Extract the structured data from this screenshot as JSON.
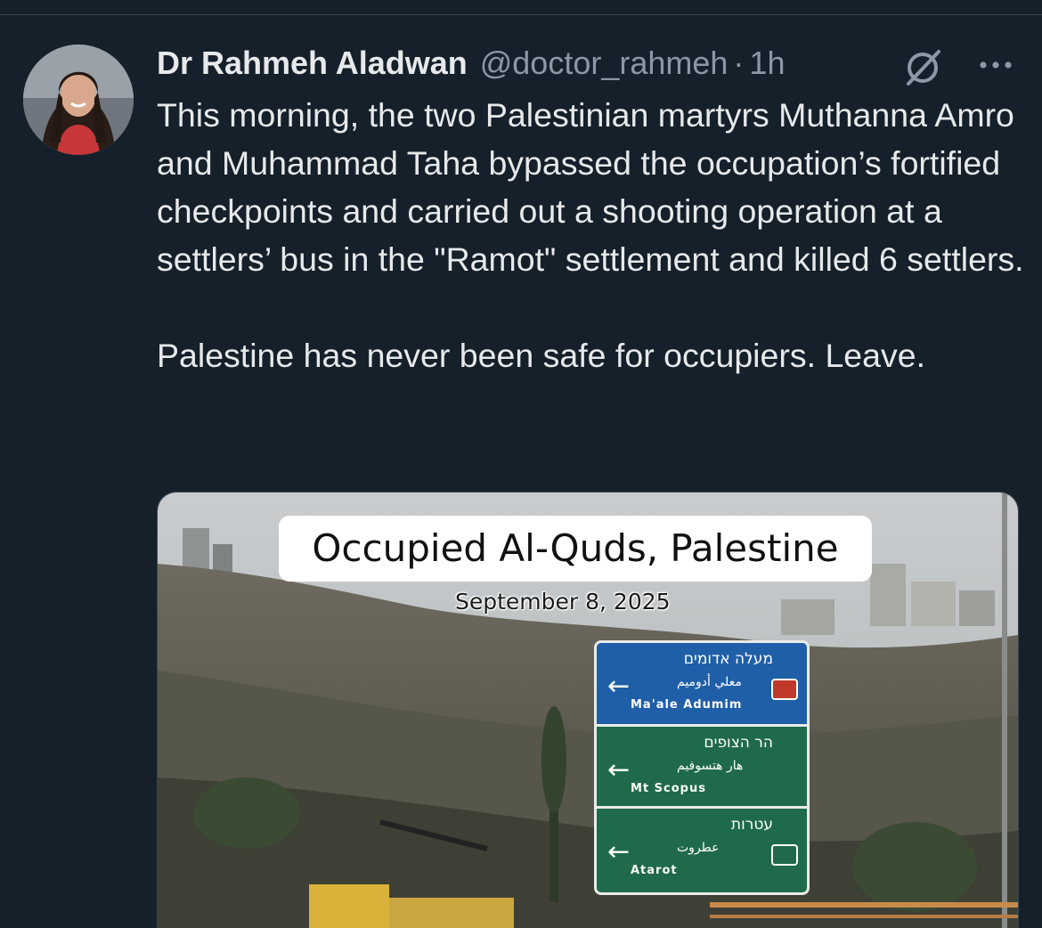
{
  "tweet": {
    "author_name": "Dr Rahmeh Aladwan",
    "handle": "@doctor_rahmeh",
    "separator": "·",
    "time": "1h",
    "grok_icon": "grok-icon",
    "more_icon": "more-dots-icon",
    "paragraphs": [
      "This morning, the two Palestinian martyrs Muthanna Amro and Muhammad Taha bypassed the occupation’s fortified checkpoints and carried out a shooting operation at a settlers’ bus in the \"Ramot\" settlement and killed 6 settlers.",
      "Palestine has never been safe for occupiers. Leave."
    ],
    "media": {
      "caption": "Occupied Al-Quds, Palestine",
      "date": "September 8, 2025",
      "sign": {
        "rows": [
          {
            "hebrew": "מעלה אדומים",
            "arabic": "معلي أدوميم",
            "english": "Ma'ale Adumim",
            "arrow": "←"
          },
          {
            "hebrew": "הר הצופים",
            "arabic": "هار هتسوفيم",
            "english": "Mt Scopus",
            "arrow": "←"
          },
          {
            "hebrew": "עטרות",
            "arabic": "عطروت",
            "english": "Atarot",
            "arrow": "←"
          }
        ]
      }
    }
  },
  "colors": {
    "background": "#15202b",
    "text_primary": "#e7e9ea",
    "text_secondary": "#8b98a5",
    "divider": "#38444d"
  }
}
